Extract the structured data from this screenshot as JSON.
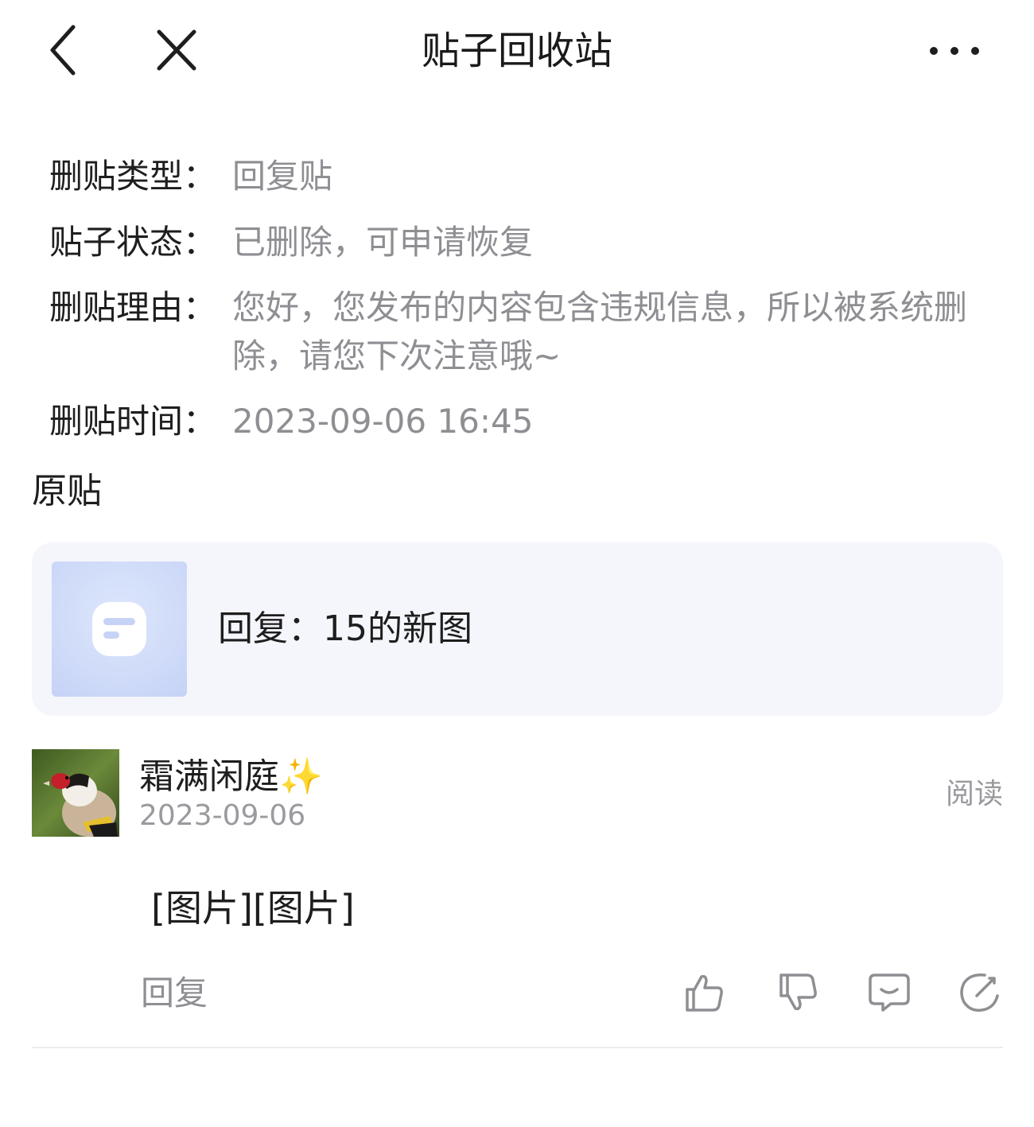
{
  "header": {
    "title": "贴子回收站"
  },
  "info": {
    "type_label": "删贴类型：",
    "type_value": "回复贴",
    "status_label": "贴子状态：",
    "status_value": "已删除，可申请恢复",
    "reason_label": "删贴理由：",
    "reason_value": "您好，您发布的内容包含违规信息，所以被系统删除，请您下次注意哦~",
    "time_label": "删贴时间：",
    "time_value": "2023-09-06 16:45"
  },
  "original": {
    "section_title": "原贴",
    "card_text": "回复：15的新图"
  },
  "post": {
    "author": "霜满闲庭✨",
    "date": "2023-09-06",
    "read_label": "阅读",
    "content": "[图片][图片]",
    "reply_label": "回复"
  },
  "icons": {
    "back": "back-chevron-icon",
    "close": "close-icon",
    "more": "more-dots-icon",
    "like": "thumbs-up-icon",
    "dislike": "thumbs-down-icon",
    "comment": "comment-icon",
    "share": "share-icon"
  }
}
